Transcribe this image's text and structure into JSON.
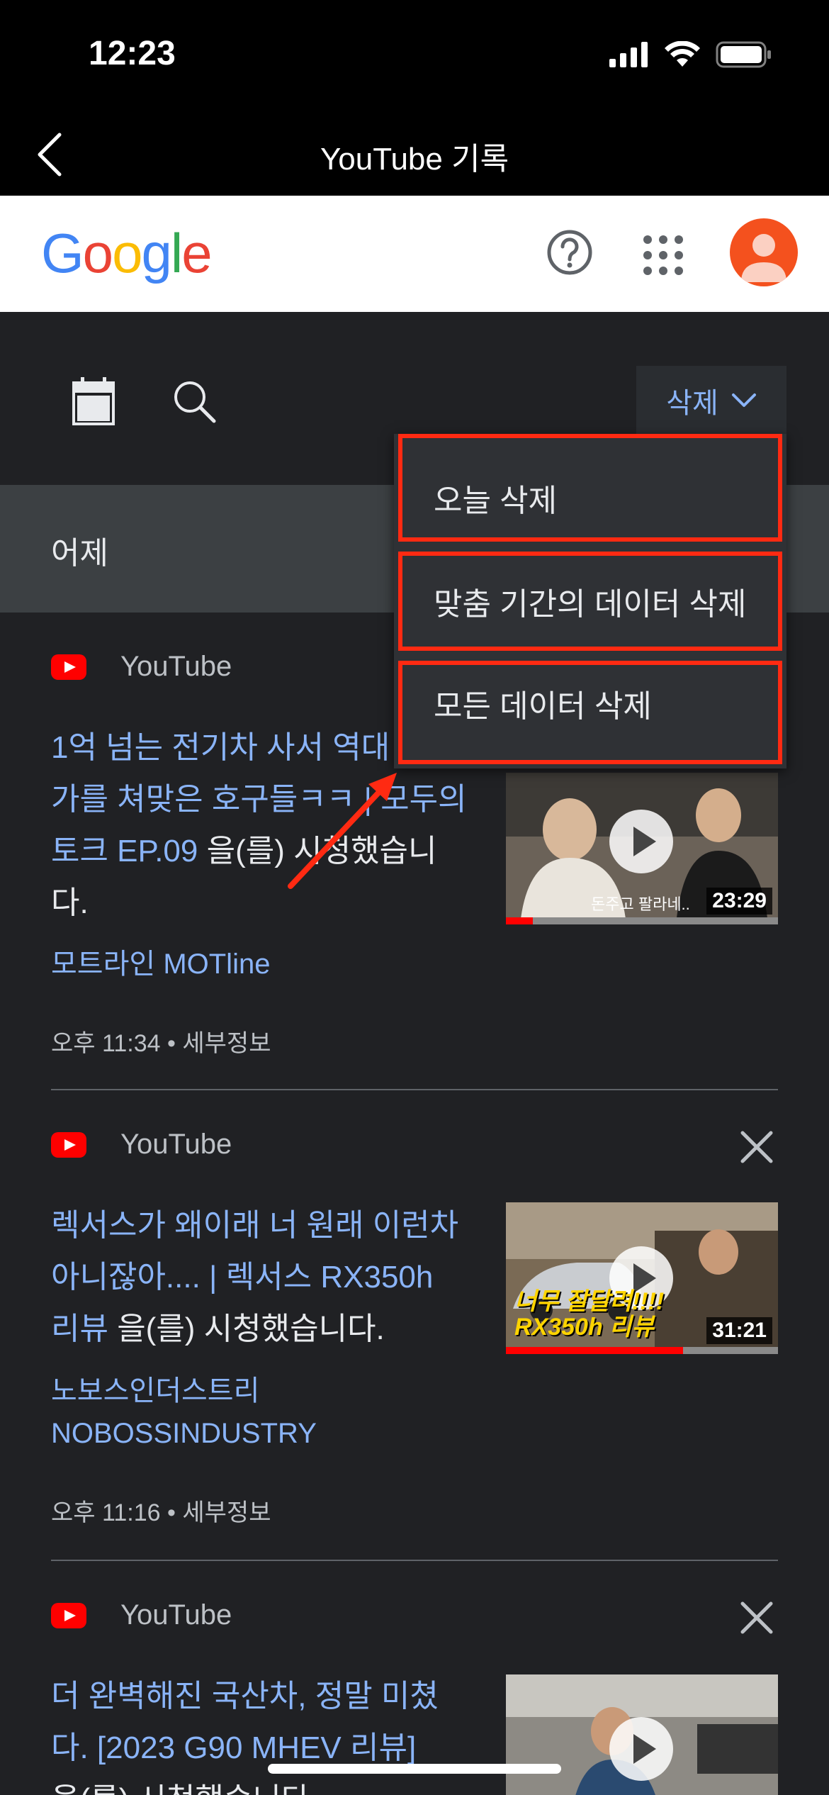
{
  "status_bar": {
    "time": "12:23"
  },
  "nav": {
    "title": "YouTube 기록"
  },
  "google": {
    "logo_letters": [
      "G",
      "o",
      "o",
      "g",
      "l",
      "e"
    ],
    "logo_colors": [
      "#4285F4",
      "#EA4335",
      "#FBBC05",
      "#4285F4",
      "#34A853",
      "#EA4335"
    ]
  },
  "toolbar": {
    "delete_label": "삭제"
  },
  "day_header": {
    "label": "어제"
  },
  "delete_menu": {
    "items": [
      {
        "label": "오늘 삭제"
      },
      {
        "label": "맞춤 기간의 데이터 삭제"
      },
      {
        "label": "모든 데이터 삭제"
      }
    ]
  },
  "entries": [
    {
      "source": "YouTube",
      "title_lines": [
        "1억 넘는 전기차 사서 역대",
        "가를 쳐맞은 호구들ㅋㅋ | 모두의",
        "토크 EP.09"
      ],
      "title_suffix": " 을(를) 시청했습니",
      "title_tail": "다.",
      "channel": "모트라인 MOTline",
      "time": "오후 11:34 • 세부정보",
      "duration": "23:29",
      "thumb_caption": "돈주고 팔라네..",
      "progress": 0.1
    },
    {
      "source": "YouTube",
      "title_lines": [
        "렉서스가 왜이래 너 원래 이런차",
        "아니잖아.... | 렉서스 RX350h",
        "리뷰"
      ],
      "title_suffix": " 을(를) 시청했습니다.",
      "title_tail": "",
      "channel_lines": [
        "노보스인더스트리",
        "NOBOSSINDUSTRY"
      ],
      "time": "오후 11:16 • 세부정보",
      "duration": "31:21",
      "thumb_caption": "너무 잘달려!!!! RX350h 리뷰",
      "progress": 0.65
    },
    {
      "source": "YouTube",
      "title_lines": [
        "더 완벽해진 국산차, 정말 미쳤",
        "다. [2023 G90 MHEV 리뷰]"
      ],
      "title_suffix": "",
      "title_tail": "을(를) 시청했습니다."
    }
  ]
}
